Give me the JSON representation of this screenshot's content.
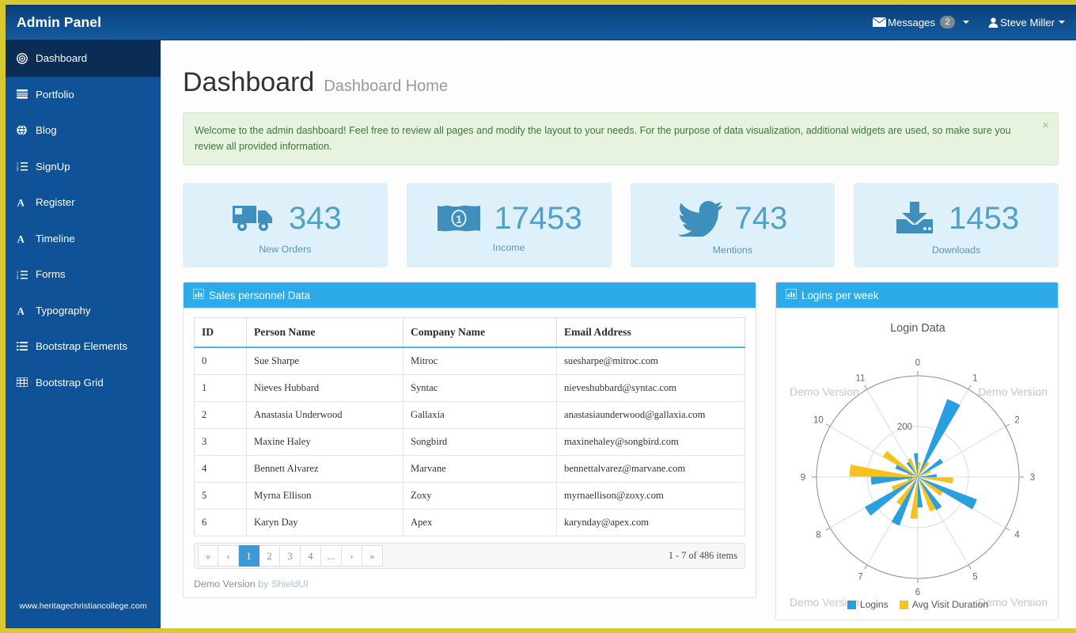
{
  "navbar": {
    "brand": "Admin Panel",
    "messages_label": "Messages",
    "messages_count": "2",
    "user_label": "Steve Miller"
  },
  "sidebar": {
    "watermark": "www.heritagechristiancollege.com",
    "items": [
      {
        "label": "Dashboard",
        "icon": "target-icon",
        "active": true
      },
      {
        "label": "Portfolio",
        "icon": "list-bars-icon",
        "active": false
      },
      {
        "label": "Blog",
        "icon": "globe-icon",
        "active": false
      },
      {
        "label": "SignUp",
        "icon": "list-ol-icon",
        "active": false
      },
      {
        "label": "Register",
        "icon": "font-a-icon",
        "active": false
      },
      {
        "label": "Timeline",
        "icon": "font-a-icon",
        "active": false
      },
      {
        "label": "Forms",
        "icon": "list-ol-icon",
        "active": false
      },
      {
        "label": "Typography",
        "icon": "font-a-icon",
        "active": false
      },
      {
        "label": "Bootstrap Elements",
        "icon": "list-icon",
        "active": false
      },
      {
        "label": "Bootstrap Grid",
        "icon": "grid-icon",
        "active": false
      }
    ]
  },
  "page": {
    "title": "Dashboard",
    "subtitle": "Dashboard Home"
  },
  "alert": {
    "text": "Welcome to the admin dashboard! Feel free to review all pages and modify the layout to your needs. For the purpose of data visualization, additional widgets are used, so make sure you review all provided information.",
    "close_label": "×"
  },
  "stats": [
    {
      "value": "343",
      "label": "New Orders",
      "icon": "truck-icon"
    },
    {
      "value": "17453",
      "label": "Income",
      "icon": "money-bill-icon"
    },
    {
      "value": "743",
      "label": "Mentions",
      "icon": "twitter-bird-icon"
    },
    {
      "value": "1453",
      "label": "Downloads",
      "icon": "download-inbox-icon"
    }
  ],
  "table_panel": {
    "title": "Sales personnel Data",
    "icon": "bar-chart-icon",
    "columns": [
      "ID",
      "Person Name",
      "Company Name",
      "Email Address"
    ],
    "rows": [
      [
        "0",
        "Sue Sharpe",
        "Mitroc",
        "suesharpe@mitroc.com"
      ],
      [
        "1",
        "Nieves Hubbard",
        "Syntac",
        "nieveshubbard@syntac.com"
      ],
      [
        "2",
        "Anastasia Underwood",
        "Gallaxia",
        "anastasiaunderwood@gallaxia.com"
      ],
      [
        "3",
        "Maxine Haley",
        "Songbird",
        "maxinehaley@songbird.com"
      ],
      [
        "4",
        "Bennett Alvarez",
        "Marvane",
        "bennettalvarez@marvane.com"
      ],
      [
        "5",
        "Myrna Ellison",
        "Zoxy",
        "myrnaellison@zoxy.com"
      ],
      [
        "6",
        "Karyn Day",
        "Apex",
        "karynday@apex.com"
      ]
    ],
    "pager": {
      "buttons": [
        "«",
        "‹",
        "1",
        "2",
        "3",
        "4",
        "...",
        "›",
        "»"
      ],
      "active_index": 2,
      "info": "1 - 7 of 486 items"
    },
    "credit_prefix": "Demo Version",
    "credit_by": "by",
    "credit_vendor": "ShieldUI"
  },
  "chart_panel": {
    "title": "Logins per week",
    "icon": "bar-chart-icon",
    "watermarks": [
      "Demo Version",
      "Demo Version",
      "Demo Version",
      "Demo Version"
    ]
  },
  "chart_data": {
    "type": "bar",
    "variant": "polar-rose",
    "title": "Login Data",
    "categories": [
      "0",
      "1",
      "2",
      "3",
      "4",
      "5",
      "6",
      "7",
      "8",
      "9",
      "10",
      "11"
    ],
    "radial_ticks": [
      "0",
      "200"
    ],
    "rlim": [
      0,
      400
    ],
    "grid": true,
    "legend_position": "bottom",
    "colors": {
      "logins": "#2a9fe0",
      "avg_visit_duration": "#f6c31c"
    },
    "series": [
      {
        "name": "Logins",
        "color": "#2a9fe0",
        "values": [
          95,
          330,
          115,
          75,
          250,
          150,
          120,
          205,
          240,
          185,
          95,
          70
        ]
      },
      {
        "name": "Avg Visit Duration",
        "color": "#f6c31c",
        "values": [
          60,
          70,
          55,
          140,
          115,
          145,
          165,
          130,
          110,
          270,
          160,
          80
        ]
      }
    ]
  }
}
